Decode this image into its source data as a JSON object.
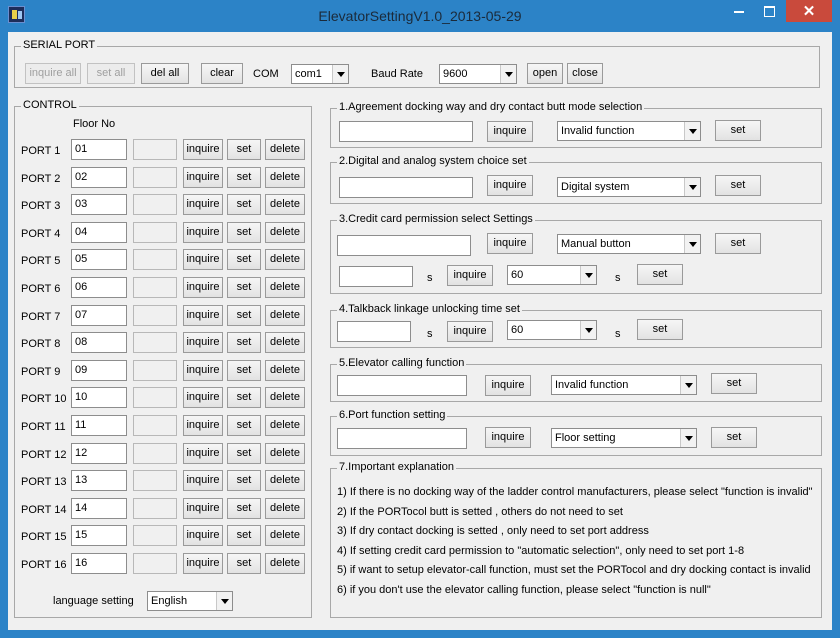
{
  "window": {
    "title": "ElevatorSettingV1.0_2013-05-29"
  },
  "serial_port": {
    "legend": "SERIAL PORT",
    "inquire_all": "inquire all",
    "set_all": "set all",
    "del_all": "del all",
    "clear": "clear",
    "com_label": "COM",
    "com_value": "com1",
    "baud_label": "Baud Rate",
    "baud_value": "9600",
    "open": "open",
    "close": "close"
  },
  "control": {
    "legend": "CONTROL",
    "floor_header": "Floor No",
    "inquire": "inquire",
    "set": "set",
    "delete": "delete",
    "ports": [
      {
        "label": "PORT 1",
        "floor": "01",
        "value": ""
      },
      {
        "label": "PORT 2",
        "floor": "02",
        "value": ""
      },
      {
        "label": "PORT 3",
        "floor": "03",
        "value": ""
      },
      {
        "label": "PORT 4",
        "floor": "04",
        "value": ""
      },
      {
        "label": "PORT 5",
        "floor": "05",
        "value": ""
      },
      {
        "label": "PORT 6",
        "floor": "06",
        "value": ""
      },
      {
        "label": "PORT 7",
        "floor": "07",
        "value": ""
      },
      {
        "label": "PORT 8",
        "floor": "08",
        "value": ""
      },
      {
        "label": "PORT 9",
        "floor": "09",
        "value": ""
      },
      {
        "label": "PORT 10",
        "floor": "10",
        "value": ""
      },
      {
        "label": "PORT 11",
        "floor": "11",
        "value": ""
      },
      {
        "label": "PORT 12",
        "floor": "12",
        "value": ""
      },
      {
        "label": "PORT 13",
        "floor": "13",
        "value": ""
      },
      {
        "label": "PORT 14",
        "floor": "14",
        "value": ""
      },
      {
        "label": "PORT 15",
        "floor": "15",
        "value": ""
      },
      {
        "label": "PORT 16",
        "floor": "16",
        "value": ""
      }
    ],
    "language_label": "language setting",
    "language_value": "English"
  },
  "sections": {
    "s1": {
      "legend": "1.Agreement docking way and dry contact butt mode selection",
      "input": "",
      "inquire": "inquire",
      "select": "Invalid function",
      "set": "set"
    },
    "s2": {
      "legend": "2.Digital and analog system choice set",
      "input": "",
      "inquire": "inquire",
      "select": "Digital system",
      "set": "set"
    },
    "s3": {
      "legend": "3.Credit card permission select Settings",
      "input": "",
      "inquire": "inquire",
      "select": "Manual button",
      "set": "set",
      "time_input": "",
      "unit": "s",
      "inquire2": "inquire",
      "time_select": "60",
      "unit2": "s",
      "set2": "set"
    },
    "s4": {
      "legend": "4.Talkback linkage unlocking time set",
      "input": "",
      "unit": "s",
      "inquire": "inquire",
      "select": "60",
      "unit2": "s",
      "set": "set"
    },
    "s5": {
      "legend": "5.Elevator calling function",
      "input": "",
      "inquire": "inquire",
      "select": "Invalid function",
      "set": "set"
    },
    "s6": {
      "legend": "6.Port function setting",
      "input": "",
      "inquire": "inquire",
      "select": "Floor setting",
      "set": "set"
    },
    "s7": {
      "legend": "7.Important explanation",
      "lines": [
        "1) If there is no docking way of the ladder control manufacturers, please select \"function is invalid\"",
        "2) If the PORTocol butt is setted , others do not need to set",
        "3) If dry contact docking is setted , only need to set port address",
        "4) If setting credit card permission to \"automatic selection\", only need to set port 1-8",
        "5) if want to setup elevator-call function, must set the PORTocol and dry docking contact is invalid",
        "6) if you don't use the elevator calling function, please select \"function is null\""
      ]
    }
  }
}
